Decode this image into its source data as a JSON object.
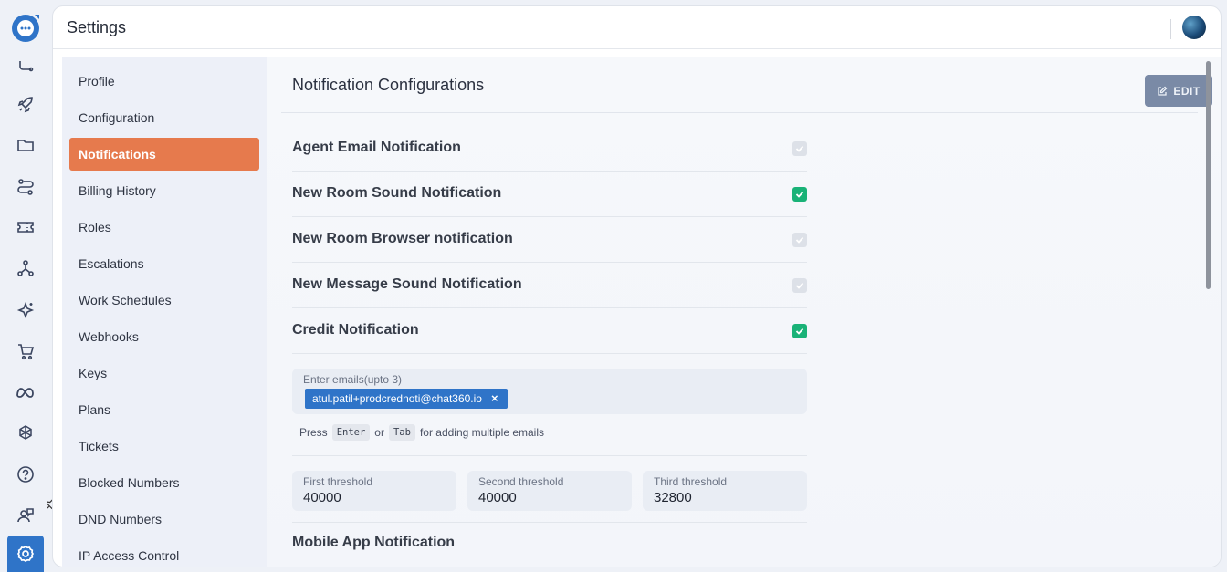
{
  "topbar": {
    "title": "Settings",
    "avatar_icon": "user-avatar"
  },
  "rail": {
    "icons": [
      "chat-logo-icon",
      "route-icon",
      "rocket-icon",
      "folder-icon",
      "flow-icon",
      "ticket-icon",
      "network-icon",
      "sparkle-icon",
      "cart-icon",
      "meta-icon",
      "openai-icon",
      "help-icon",
      "agent-support-icon",
      "settings-icon"
    ],
    "active_color": "#2f74c8"
  },
  "submenu": {
    "items": [
      {
        "label": "Profile"
      },
      {
        "label": "Configuration"
      },
      {
        "label": "Notifications"
      },
      {
        "label": "Billing History"
      },
      {
        "label": "Roles"
      },
      {
        "label": "Escalations"
      },
      {
        "label": "Work Schedules"
      },
      {
        "label": "Webhooks"
      },
      {
        "label": "Keys"
      },
      {
        "label": "Plans"
      },
      {
        "label": "Tickets"
      },
      {
        "label": "Blocked Numbers"
      },
      {
        "label": "DND Numbers"
      },
      {
        "label": "IP Access Control"
      }
    ],
    "selected_color": "#e67a4d"
  },
  "content": {
    "heading": "Notification Configurations",
    "edit_label": "EDIT",
    "notifications": [
      {
        "label": "Agent Email Notification",
        "checked": false
      },
      {
        "label": "New Room Sound Notification",
        "checked": true
      },
      {
        "label": "New Room Browser notification",
        "checked": false
      },
      {
        "label": "New Message Sound Notification",
        "checked": false
      },
      {
        "label": "Credit Notification",
        "checked": true
      }
    ],
    "emails": {
      "placeholder": "Enter emails(upto 3)",
      "chips": [
        "atul.patil+prodcrednoti@chat360.io"
      ],
      "hint_prefix": "Press",
      "hint_key1": "Enter",
      "hint_or": "or",
      "hint_key2": "Tab",
      "hint_suffix": "for adding multiple emails"
    },
    "thresholds": [
      {
        "label": "First threshold",
        "value": "40000"
      },
      {
        "label": "Second threshold",
        "value": "40000"
      },
      {
        "label": "Third threshold",
        "value": "32800"
      }
    ],
    "mobile_heading": "Mobile App Notification",
    "checked_color": "#19b277"
  }
}
